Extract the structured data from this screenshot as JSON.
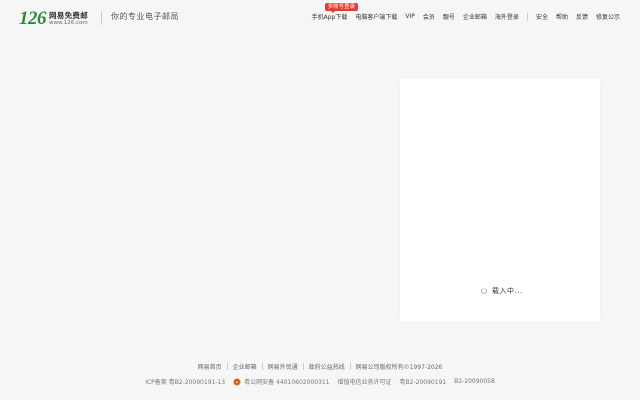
{
  "header": {
    "logo_number": "126",
    "logo_name": "网易免费邮",
    "logo_url": "www.126.com",
    "slogan": "你的专业电子邮局",
    "nav": {
      "app_download": "手机App下载",
      "app_badge": "多账号登录",
      "pc_client": "电脑客户端下载",
      "vip": "VIP",
      "member": "会员",
      "pretty_number": "靓号",
      "enterprise": "企业邮箱",
      "overseas": "海外登录",
      "security": "安全",
      "help": "帮助",
      "feedback": "反馈",
      "notice": "修复公示"
    }
  },
  "login_card": {
    "loading_text": "载入中..."
  },
  "footer": {
    "links": {
      "netease_home": "网易首页",
      "enterprise_mail": "企业邮箱",
      "foreign_trade": "网易外贸通",
      "gov_hotline": "政府公益热线",
      "copyright": "网易公司版权所有©1997-2026"
    },
    "registration": {
      "icp": "ICP备案 粤B2-20090191-13",
      "psb": "粤公网安备 44010602000311",
      "telecom_license": "增值电信业务许可证",
      "telecom_number": "粤B2-20090191",
      "license_2": "B2-20090058"
    }
  },
  "colors": {
    "brand_green": "#2b8a3a",
    "badge_red": "#e63b2e",
    "page_bg": "#f6f6f6",
    "card_bg": "#ffffff"
  },
  "icons": [
    "loading-spinner-icon",
    "police-emblem-icon"
  ]
}
